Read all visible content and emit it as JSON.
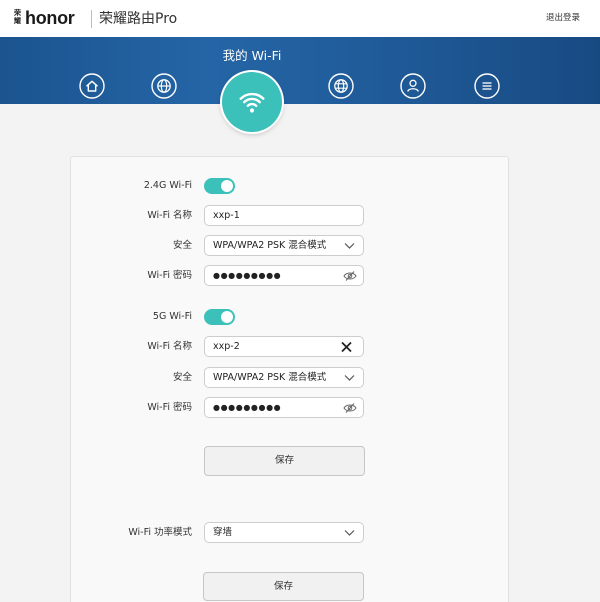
{
  "header": {
    "logo_cn": "荣耀",
    "logo_text": "honor",
    "product_title": "荣耀路由Pro",
    "logout_label": "退出登录"
  },
  "banner": {
    "title": "我的 Wi-Fi",
    "nav_icons": [
      "home-icon",
      "globe-icon",
      "wifi-icon",
      "globe-grid-icon",
      "user-icon",
      "menu-icon"
    ],
    "active_icon": "wifi-icon"
  },
  "wifi_2g": {
    "band_label": "2.4G Wi-Fi",
    "enabled": true,
    "name_label": "Wi-Fi 名称",
    "name_value": "xxp-1",
    "security_label": "安全",
    "security_value": "WPA/WPA2 PSK 混合模式",
    "password_label": "Wi-Fi 密码",
    "password_mask": "●●●●●●●●●"
  },
  "wifi_5g": {
    "band_label": "5G Wi-Fi",
    "enabled": true,
    "name_label": "Wi-Fi 名称",
    "name_value": "xxp-2",
    "security_label": "安全",
    "security_value": "WPA/WPA2 PSK 混合模式",
    "password_label": "Wi-Fi 密码",
    "password_mask": "●●●●●●●●●"
  },
  "wifi_save_label": "保存",
  "power_mode": {
    "label": "Wi-Fi 功率模式",
    "value": "穿墙",
    "save_label": "保存"
  },
  "colors": {
    "accent": "#3cc0ba",
    "banner": "#1f5a98",
    "page_background": "#f3f3f3"
  }
}
